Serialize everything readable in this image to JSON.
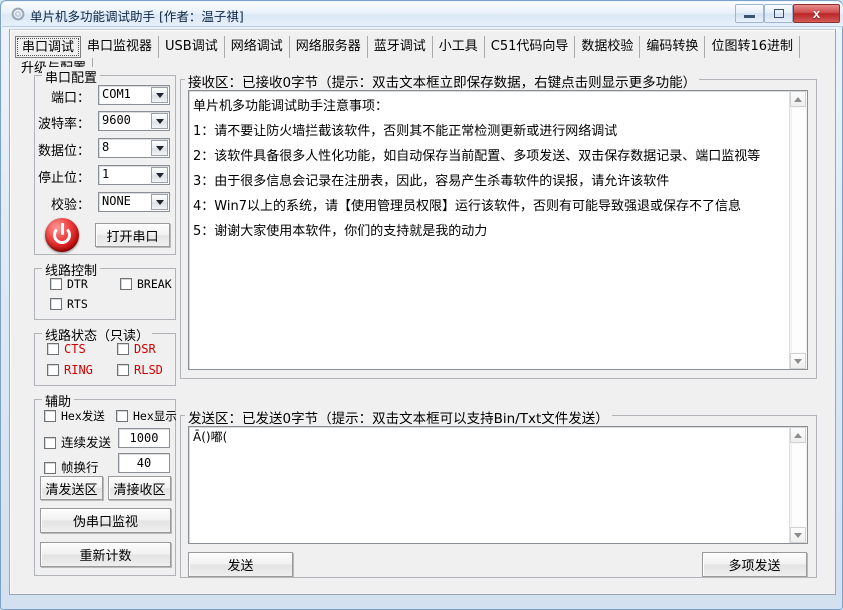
{
  "window": {
    "title": "单片机多功能调试助手 [作者：温子祺]",
    "icon": "app-gear-icon",
    "buttons": {
      "minimize": "minimize-icon",
      "maximize": "maximize-icon",
      "close": "x"
    }
  },
  "tabs": [
    {
      "label": "串口调试",
      "selected": true
    },
    {
      "label": "串口监视器",
      "selected": false
    },
    {
      "label": "USB调试",
      "selected": false
    },
    {
      "label": "网络调试",
      "selected": false
    },
    {
      "label": "网络服务器",
      "selected": false
    },
    {
      "label": "蓝牙调试",
      "selected": false
    },
    {
      "label": "小工具",
      "selected": false
    },
    {
      "label": "C51代码向导",
      "selected": false
    },
    {
      "label": "数据校验",
      "selected": false
    },
    {
      "label": "编码转换",
      "selected": false
    },
    {
      "label": "位图转16进制",
      "selected": false
    },
    {
      "label": "升级与配置",
      "selected": false
    }
  ],
  "serial_config": {
    "legend": "串口配置",
    "fields": [
      {
        "label": "端口：",
        "value": "COM1"
      },
      {
        "label": "波特率：",
        "value": "9600"
      },
      {
        "label": "数据位：",
        "value": "8"
      },
      {
        "label": "停止位：",
        "value": "1"
      },
      {
        "label": "校验：",
        "value": "NONE"
      }
    ],
    "open_button": "打开串口",
    "power_icon": "power-icon"
  },
  "line_control": {
    "legend": "线路控制",
    "items": [
      {
        "label": "DTR",
        "checked": false
      },
      {
        "label": "BREAK",
        "checked": false
      },
      {
        "label": "RTS",
        "checked": false
      }
    ]
  },
  "line_status": {
    "legend": "线路状态（只读）",
    "color": "#d40000",
    "items": [
      {
        "label": "CTS",
        "checked": false
      },
      {
        "label": "DSR",
        "checked": false
      },
      {
        "label": "RING",
        "checked": false
      },
      {
        "label": "RLSD",
        "checked": false
      }
    ]
  },
  "auxiliary": {
    "legend": "辅助",
    "hex_send": {
      "label": "Hex发送",
      "checked": false
    },
    "hex_show": {
      "label": "Hex显示",
      "checked": false
    },
    "continuous_send": {
      "label": "连续发送",
      "checked": false,
      "value": "1000"
    },
    "frame_newline": {
      "label": "帧换行",
      "checked": false,
      "value": "40"
    },
    "clear_send_button": "清发送区",
    "clear_recv_button": "清接收区",
    "pseudo_monitor_button": "伪串口监视",
    "recount_button": "重新计数"
  },
  "receive": {
    "title": "接收区：已接收0字节（提示：双击文本框立即保存数据，右键点击则显示更多功能）",
    "lines": [
      "单片机多功能调试助手注意事项：",
      "1：请不要让防火墙拦截该软件，否则其不能正常检测更新或进行网络调试",
      "2：该软件具备很多人性化功能，如自动保存当前配置、多项发送、双击保存数据记录、端口监视等",
      "3：由于很多信息会记录在注册表，因此，容易产生杀毒软件的误报，请允许该软件",
      "4：Win7以上的系统，请【使用管理员权限】运行该软件，否则有可能导致强退或保存不了信息",
      "5：谢谢大家使用本软件，你们的支持就是我的动力"
    ]
  },
  "send": {
    "title": "发送区：已发送0字节（提示：双击文本框可以支持Bin/Txt文件发送）",
    "content": "Ā()嘟(",
    "send_button": "发送",
    "multi_send_button": "多项发送"
  }
}
